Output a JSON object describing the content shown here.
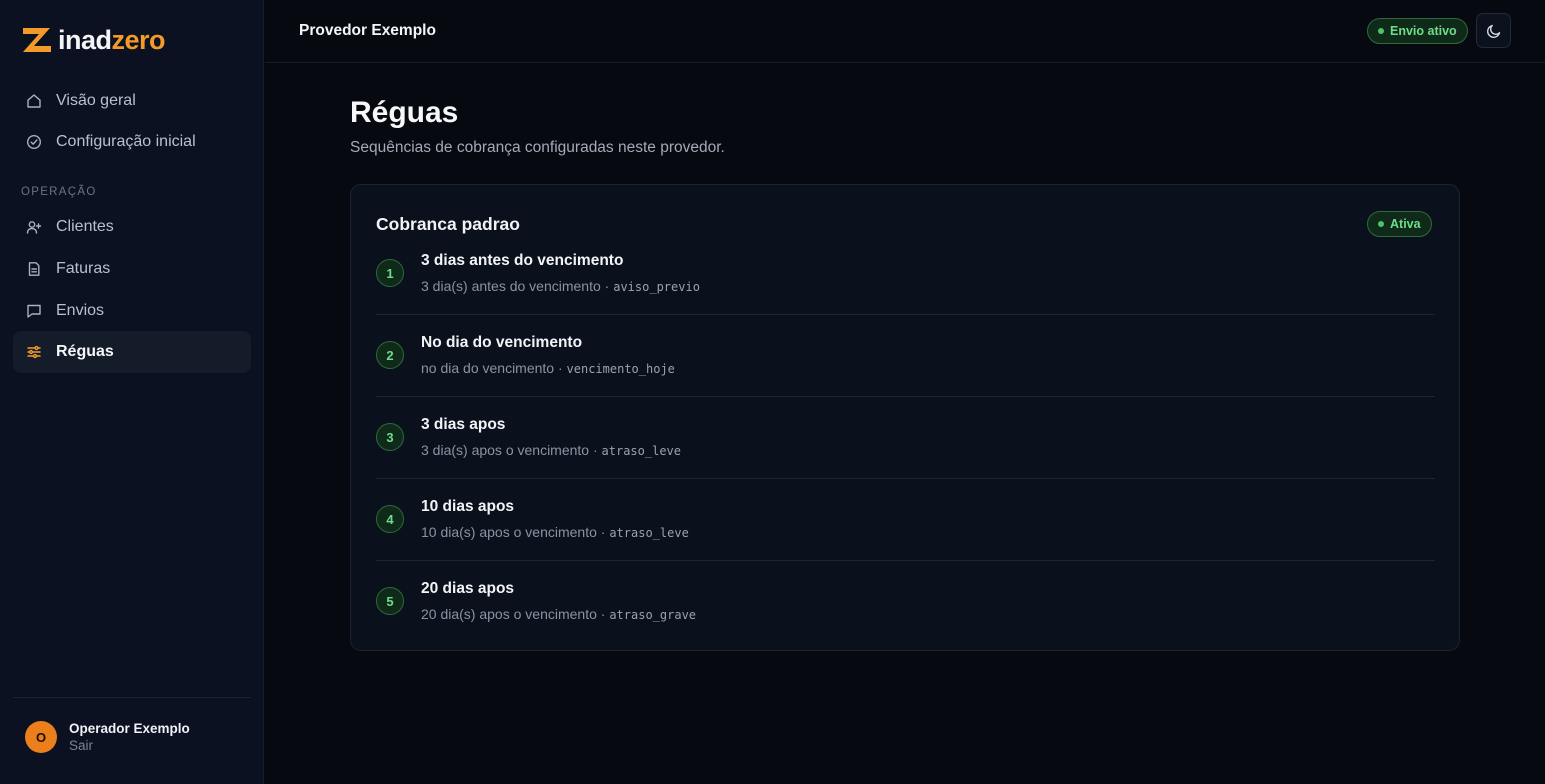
{
  "brand": {
    "part1": "inad",
    "part2": "zero"
  },
  "nav": {
    "items": [
      {
        "label": "Visão geral",
        "icon": "home-icon"
      },
      {
        "label": "Configuração inicial",
        "icon": "check-circle-icon"
      }
    ],
    "section_label": "OPERAÇÃO",
    "operation_items": [
      {
        "label": "Clientes",
        "icon": "user-plus-icon"
      },
      {
        "label": "Faturas",
        "icon": "document-icon"
      },
      {
        "label": "Envios",
        "icon": "message-icon"
      },
      {
        "label": "Réguas",
        "icon": "sliders-icon",
        "active": true
      }
    ]
  },
  "user": {
    "initial": "O",
    "name": "Operador Exemplo",
    "logout": "Sair"
  },
  "header": {
    "provider": "Provedor Exemplo",
    "status_badge": "Envio ativo",
    "theme_icon": "moon-icon"
  },
  "page": {
    "title": "Réguas",
    "subtitle": "Sequências de cobrança configuradas neste provedor."
  },
  "ruler": {
    "name": "Cobranca padrao",
    "status": "Ativa",
    "steps": [
      {
        "num": "1",
        "title": "3 dias antes do vencimento",
        "desc": "3 dia(s) antes do vencimento · ",
        "code": "aviso_previo"
      },
      {
        "num": "2",
        "title": "No dia do vencimento",
        "desc": "no dia do vencimento · ",
        "code": "vencimento_hoje"
      },
      {
        "num": "3",
        "title": "3 dias apos",
        "desc": "3 dia(s) apos o vencimento · ",
        "code": "atraso_leve"
      },
      {
        "num": "4",
        "title": "10 dias apos",
        "desc": "10 dia(s) apos o vencimento · ",
        "code": "atraso_leve"
      },
      {
        "num": "5",
        "title": "20 dias apos",
        "desc": "20 dia(s) apos o vencimento · ",
        "code": "atraso_grave"
      }
    ]
  },
  "colors": {
    "accent_orange": "#f39a2a",
    "success_green": "#6fdc8c",
    "background": "#06090f",
    "sidebar": "#0b1120"
  }
}
